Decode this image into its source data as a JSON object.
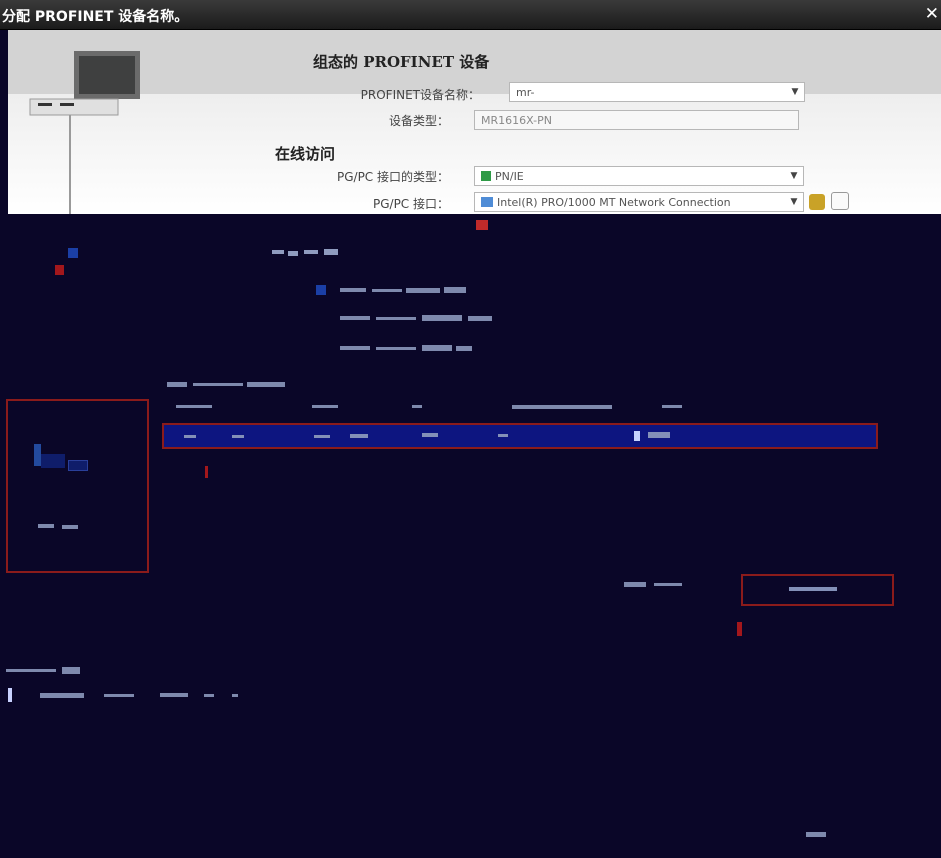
{
  "dialog": {
    "title": "分配 PROFINET 设备名称。",
    "close_glyph": "✕"
  },
  "configured_device": {
    "heading": "组态的 PROFINET 设备",
    "name_label": "PROFINET设备名称：",
    "name_value": "mr-",
    "type_label": "设备类型：",
    "type_value": "MR1616X-PN"
  },
  "online_access": {
    "heading": "在线访问",
    "interface_type_label": "PG/PC 接口的类型：",
    "interface_type_value": "PN/IE",
    "interface_label": "PG/PC 接口：",
    "interface_value": "Intel(R) PRO/1000 MT Network Connection"
  },
  "icons": {
    "device": "computer-monitor-icon",
    "network": "network-adapter-icon",
    "dropdown": "chevron-down-icon"
  },
  "colors": {
    "title_bar": "#1b1b1b",
    "highlight_frame": "#8b1b1b",
    "selected_row": "#0d1580",
    "dark_background": "#0a0628"
  }
}
